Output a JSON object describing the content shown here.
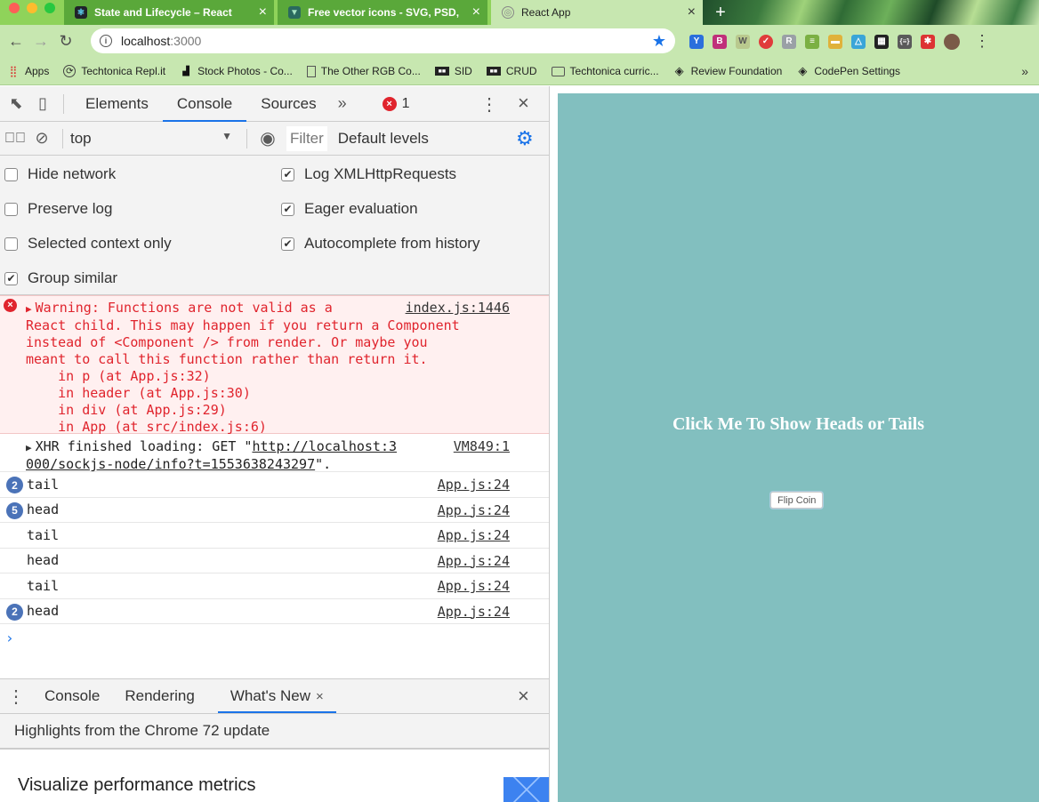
{
  "browser": {
    "tabs": [
      {
        "title": "State and Lifecycle – React",
        "favicon": "react-icon",
        "active": false
      },
      {
        "title": "Free vector icons - SVG, PSD,",
        "favicon": "flaticon-icon",
        "active": false
      },
      {
        "title": "React App",
        "favicon": "globe-icon",
        "active": true
      }
    ],
    "address": {
      "host": "localhost",
      "port": ":3000"
    },
    "bookmarks": [
      {
        "label": "Apps",
        "icon": "apps-grid-icon"
      },
      {
        "label": "Techtonica Repl.it",
        "icon": "repl-icon"
      },
      {
        "label": "Stock Photos - Co...",
        "icon": "camera-icon"
      },
      {
        "label": "The Other RGB Co...",
        "icon": "page-icon"
      },
      {
        "label": "SID",
        "icon": "window-icon"
      },
      {
        "label": "CRUD",
        "icon": "window-icon"
      },
      {
        "label": "Techtonica curric...",
        "icon": "folder-icon"
      },
      {
        "label": "Review Foundation",
        "icon": "codepen-icon"
      },
      {
        "label": "CodePen Settings",
        "icon": "codepen-icon"
      }
    ],
    "bookmarks_more": "»"
  },
  "devtools": {
    "tabs": [
      "Elements",
      "Console",
      "Sources"
    ],
    "active_tab": "Console",
    "more": "»",
    "error_count": "1",
    "context": "top",
    "filter_placeholder": "Filter",
    "levels": "Default levels",
    "settings": {
      "left": [
        {
          "label": "Hide network",
          "checked": false
        },
        {
          "label": "Preserve log",
          "checked": false
        },
        {
          "label": "Selected context only",
          "checked": false
        },
        {
          "label": "Group similar",
          "checked": true
        }
      ],
      "right": [
        {
          "label": "Log XMLHttpRequests",
          "checked": true
        },
        {
          "label": "Eager evaluation",
          "checked": true
        },
        {
          "label": "Autocomplete from history",
          "checked": true
        }
      ]
    },
    "error_message": {
      "lines": [
        "Warning: Functions are not valid as a",
        "React child. This may happen if you return a Component",
        "instead of <Component /> from render. Or maybe you",
        "meant to call this function rather than return it.",
        "    in p (at App.js:32)",
        "    in header (at App.js:30)",
        "    in div (at App.js:29)",
        "    in App (at src/index.js:6)"
      ],
      "source": "index.js:1446"
    },
    "xhr_message": {
      "prefix": "XHR finished loading: GET \"",
      "link_a": "http://localhost:3",
      "link_b": "000/sockjs-node/info?t=1553638243297",
      "suffix": "\".",
      "source": "VM849:1"
    },
    "logs": [
      {
        "text": "tail",
        "count": "2",
        "source": "App.js:24"
      },
      {
        "text": "head",
        "count": "5",
        "source": "App.js:24"
      },
      {
        "text": "tail",
        "count": "",
        "source": "App.js:24"
      },
      {
        "text": "head",
        "count": "",
        "source": "App.js:24"
      },
      {
        "text": "tail",
        "count": "",
        "source": "App.js:24"
      },
      {
        "text": "head",
        "count": "2",
        "source": "App.js:24"
      }
    ],
    "drawer": {
      "tabs": [
        "Console",
        "Rendering",
        "What's New"
      ],
      "active_tab": "What's New",
      "highlights": "Highlights from the Chrome 72 update",
      "feature_title": "Visualize performance metrics"
    }
  },
  "page": {
    "heading": "Click Me To Show Heads or Tails",
    "button_label": "Flip Coin",
    "background_color": "#82bfbf"
  }
}
